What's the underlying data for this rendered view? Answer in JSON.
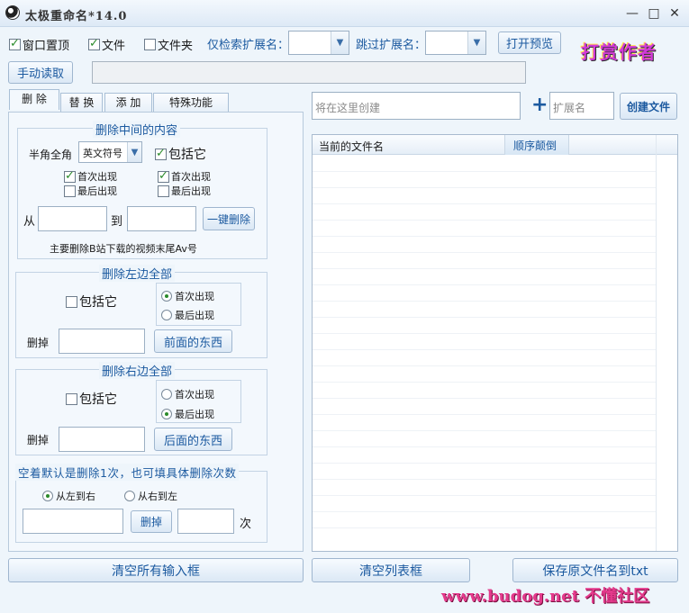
{
  "window": {
    "title": "太极重命名*14.0",
    "minimize": "—",
    "maximize": "□",
    "close": "✕"
  },
  "toolbar": {
    "pin_top": {
      "label": "窗口置顶",
      "checked": true
    },
    "files": {
      "label": "文件",
      "checked": true
    },
    "folders": {
      "label": "文件夹",
      "checked": false
    },
    "only_ext_label": "仅检索扩展名：",
    "skip_ext_label": "跳过扩展名：",
    "open_preview": "打开预览",
    "manual_read": "手动读取",
    "logo": "打赏作者"
  },
  "tabs": [
    "删 除",
    "替 换",
    "添 加",
    "特殊功能"
  ],
  "delete_middle": {
    "title": "删除中间的内容",
    "width_label": "半角全角",
    "symbol_select": "英文符号",
    "include_it": "包括它",
    "left_first": {
      "label": "首次出现",
      "checked": true
    },
    "left_last": {
      "label": "最后出现",
      "checked": false
    },
    "right_first": {
      "label": "首次出现",
      "checked": true
    },
    "right_last": {
      "label": "最后出现",
      "checked": false
    },
    "from_label": "从",
    "to_label": "到",
    "one_click": "一键删除",
    "note": "主要删除B站下载的视频末尾Av号"
  },
  "delete_left": {
    "title": "删除左边全部",
    "include_it": "包括它",
    "first": "首次出现",
    "last": "最后出现",
    "delete_label": "删掉",
    "button": "前面的东西"
  },
  "delete_right": {
    "title": "删除右边全部",
    "include_it": "包括它",
    "first": "首次出现",
    "last": "最后出现",
    "delete_label": "删掉",
    "button": "后面的东西"
  },
  "delete_count": {
    "title": "空着默认是删除1次，也可填具体删除次数",
    "left_to_right": "从左到右",
    "right_to_left": "从右到左",
    "delete_btn": "删掉",
    "times_label": "次"
  },
  "create": {
    "placeholder": "将在这里创建",
    "plus": "+",
    "ext_placeholder": "扩展名",
    "button": "创建文件"
  },
  "file_list": {
    "col_name": "当前的文件名",
    "col_reverse": "顺序颠倒"
  },
  "bottom": {
    "clear_inputs": "清空所有输入框",
    "clear_list": "清空列表框",
    "save_names": "保存原文件名到txt"
  },
  "watermark": "www.budog.net 不懂社区"
}
